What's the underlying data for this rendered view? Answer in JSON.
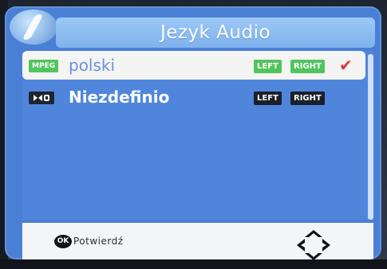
{
  "dialog": {
    "title": "Jezyk Audio"
  },
  "tracks": [
    {
      "codec": "MPEG",
      "language": "polski",
      "left": "LEFT",
      "right": "RIGHT",
      "selected": true,
      "checkmark": "✔"
    },
    {
      "codec": "DOLBY",
      "codec_display": "▯◖◗ D",
      "language": "Niezdefinio",
      "left": "LEFT",
      "right": "RIGHT",
      "selected": false
    }
  ],
  "footer": {
    "ok_button": "OK",
    "ok_label": "Potwierdź",
    "nav_icon": "dpad-arrows-icon"
  },
  "colors": {
    "dialog_bg": "#4a7fd6",
    "title_bar": "#8fbff2",
    "selected_row": "#f4f4f2",
    "badge_green": "#52c45e",
    "badge_dark": "#1b1f28",
    "check_red": "#e0323a",
    "footer_bg": "#f4f5f6"
  }
}
